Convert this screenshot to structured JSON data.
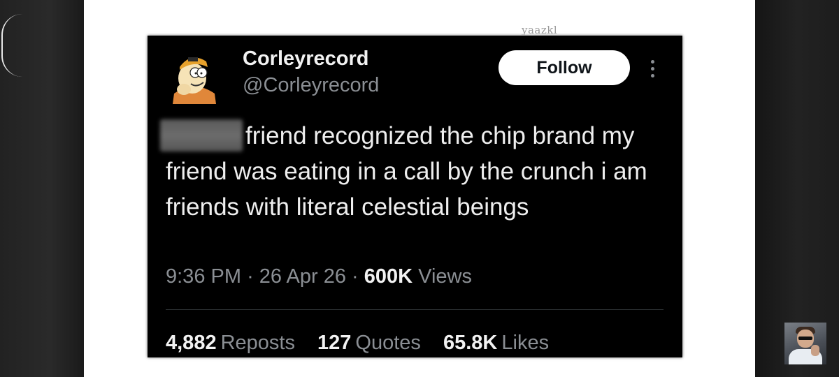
{
  "watermark": "yaazkl",
  "tweet": {
    "display_name": "Corleyrecord",
    "handle": "@Corleyrecord",
    "follow_label": "Follow",
    "body": "friend recognized the chip brand my friend was eating in a call by the crunch i am friends with literal celestial beings",
    "time": "9:36 PM",
    "separator": "·",
    "date": "26 Apr 26",
    "views_count": "600K",
    "views_label": "Views",
    "reposts_count": "4,882",
    "reposts_label": "Reposts",
    "quotes_count": "127",
    "quotes_label": "Quotes",
    "likes_count": "65.8K",
    "likes_label": "Likes"
  },
  "icons": {
    "avatar": "cartoon-avatar",
    "more": "more-options-icon"
  },
  "colors": {
    "tweet_background": "#000000",
    "secondary_text": "#8b8f94",
    "follow_button": "#ffffff"
  }
}
